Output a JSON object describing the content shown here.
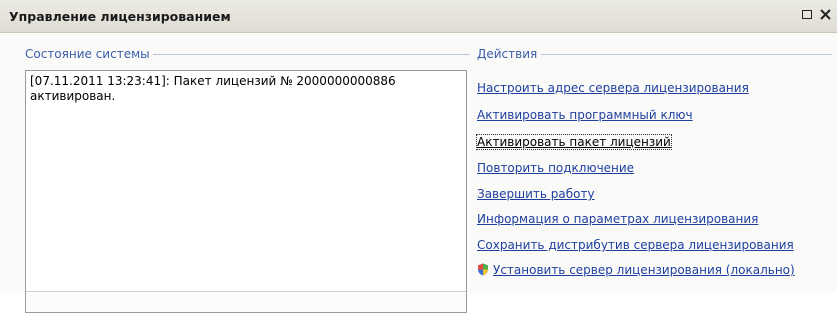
{
  "window": {
    "title": "Управление лицензированием"
  },
  "state_group": {
    "caption": "Состояние системы",
    "log_text": "[07.11.2011 13:23:41]: Пакет лицензий № 2000000000886\nактивирован."
  },
  "actions_group": {
    "caption": "Действия",
    "items": [
      {
        "label": "Настроить адрес сервера лицензирования"
      },
      {
        "label": "Активировать программный ключ"
      },
      {
        "label": "Активировать пакет лицензий"
      },
      {
        "label": "Повторить подключение"
      },
      {
        "label": "Завершить работу"
      },
      {
        "label": "Информация о параметрах лицензирования"
      },
      {
        "label": "Сохранить дистрибутив сервера лицензирования"
      },
      {
        "label": "Установить сервер лицензирования (локально)",
        "icon": "shield-icon"
      }
    ]
  },
  "colors": {
    "caption": "#3c5ea8",
    "link": "#1f3fa0"
  }
}
